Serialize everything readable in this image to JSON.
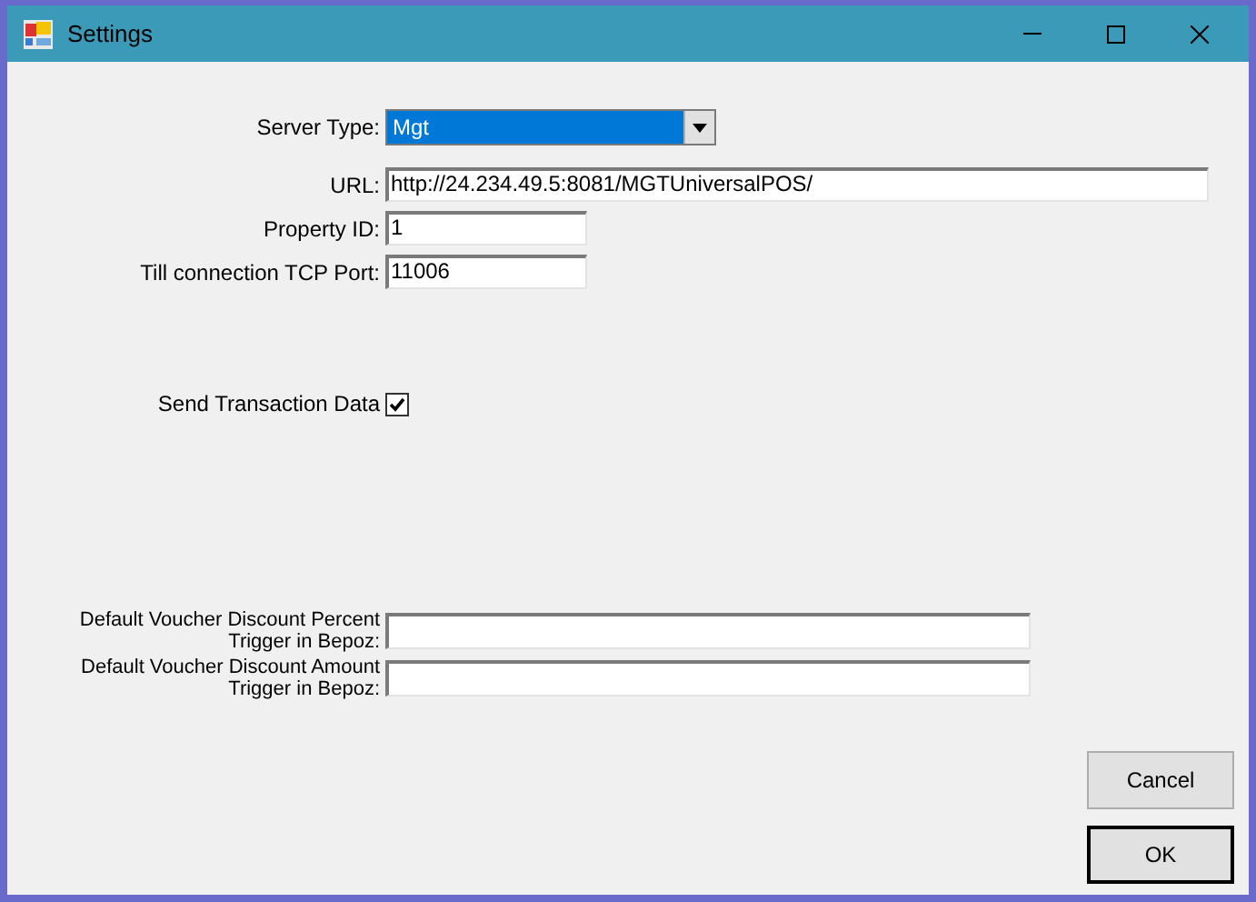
{
  "window": {
    "title": "Settings"
  },
  "fields": [
    {
      "kind": "select",
      "label": "Server Type:",
      "value": "Mgt"
    },
    {
      "kind": "text",
      "label": "URL:",
      "value": "http://24.234.49.5:8081/MGTUniversalPOS/"
    },
    {
      "kind": "text",
      "label": "Property ID:",
      "value": "1"
    },
    {
      "kind": "text",
      "label": "Till connection TCP Port:",
      "value": "11006"
    }
  ],
  "send_transaction_data": {
    "label": "Send Transaction Data",
    "checked": true
  },
  "voucher_fields": [
    {
      "label": "Default Voucher Discount Percent Trigger in Bepoz:"
    },
    {
      "label": "Default Voucher Discount Amount Trigger in Bepoz:"
    }
  ],
  "buttons": [
    {
      "label": "Cancel",
      "default": false
    },
    {
      "label": "OK",
      "default": true
    }
  ]
}
